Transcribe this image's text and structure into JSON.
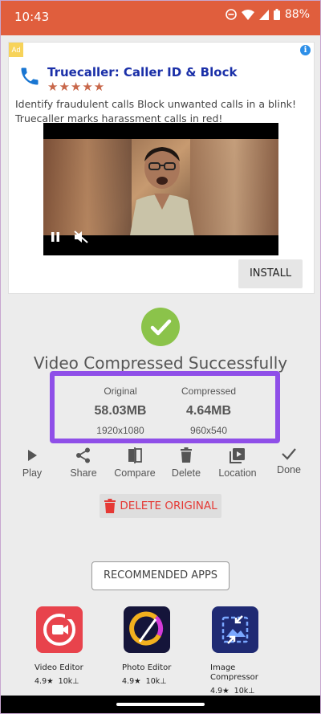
{
  "status_bar": {
    "time": "10:43",
    "battery": "88%"
  },
  "ad": {
    "badge": "Ad",
    "info": "i",
    "title": "Truecaller: Caller ID & Block",
    "stars": "★★★★★",
    "description": "Identify fraudulent calls Block unwanted calls in a blink! Truecaller marks harassment calls in red!",
    "install_label": "INSTALL"
  },
  "result": {
    "title": "Video Compressed Successfully",
    "original": {
      "label": "Original",
      "size": "58.03MB",
      "resolution": "1920x1080"
    },
    "compressed": {
      "label": "Compressed",
      "size": "4.64MB",
      "resolution": "960x540"
    }
  },
  "actions": [
    {
      "label": "Play",
      "icon": "play-icon"
    },
    {
      "label": "Share",
      "icon": "share-icon"
    },
    {
      "label": "Compare",
      "icon": "compare-icon"
    },
    {
      "label": "Delete",
      "icon": "trash-icon"
    },
    {
      "label": "Location",
      "icon": "folder-video-icon"
    },
    {
      "label": "Done",
      "icon": "check-icon"
    }
  ],
  "delete_original_label": "DELETE ORIGINAL",
  "recommended_label": "RECOMMENDED APPS",
  "apps": [
    {
      "name": "Video Editor",
      "rating": "4.9★",
      "downloads": "10k⊥"
    },
    {
      "name": "Photo Editor",
      "rating": "4.9★",
      "downloads": "10k⊥"
    },
    {
      "name": "Image Compressor",
      "name_line1": "Image",
      "name_line2": "Compressor",
      "rating": "4.9★",
      "downloads": "10k⊥"
    }
  ],
  "colors": {
    "status_bar": "#e05e3d",
    "highlight_border": "#8f4fe8",
    "success_green": "#8bc34a",
    "delete_red": "#e53935",
    "ad_title_blue": "#1a2fa8"
  }
}
